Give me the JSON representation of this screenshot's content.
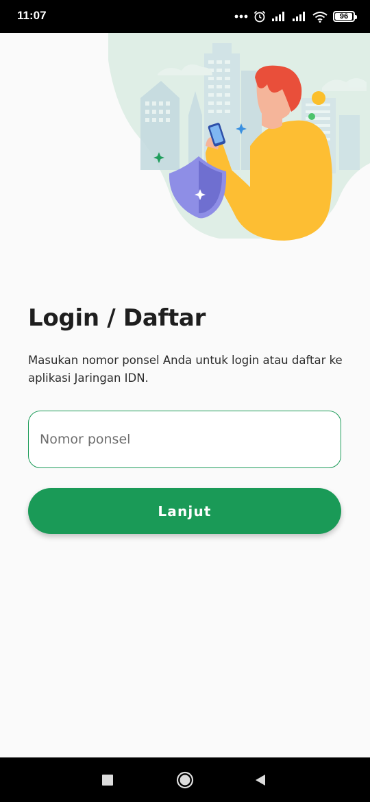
{
  "status_bar": {
    "time": "11:07",
    "battery_level": "96",
    "icons": [
      "more-dots-icon",
      "alarm-icon",
      "signal-icon",
      "signal-icon",
      "wifi-icon",
      "battery-icon"
    ]
  },
  "illustration": {
    "description_icon": "security-login-illustration",
    "colors": {
      "green_blob": "#dfeee6",
      "person_shirt": "#fdbe33",
      "person_hair": "#e94f3a",
      "shield": "#8e8ee6"
    }
  },
  "login": {
    "title": "Login / Daftar",
    "subtitle": "Masukan nomor ponsel Anda untuk login atau daftar ke aplikasi Jaringan IDN.",
    "phone_placeholder": "Nomor ponsel",
    "phone_value": "",
    "continue_label": "Lanjut"
  },
  "theme": {
    "accent": "#1a9a57",
    "background": "#fafafa"
  },
  "nav_bar": {
    "icons": [
      "recents-square-icon",
      "home-circle-icon",
      "back-triangle-icon"
    ]
  }
}
